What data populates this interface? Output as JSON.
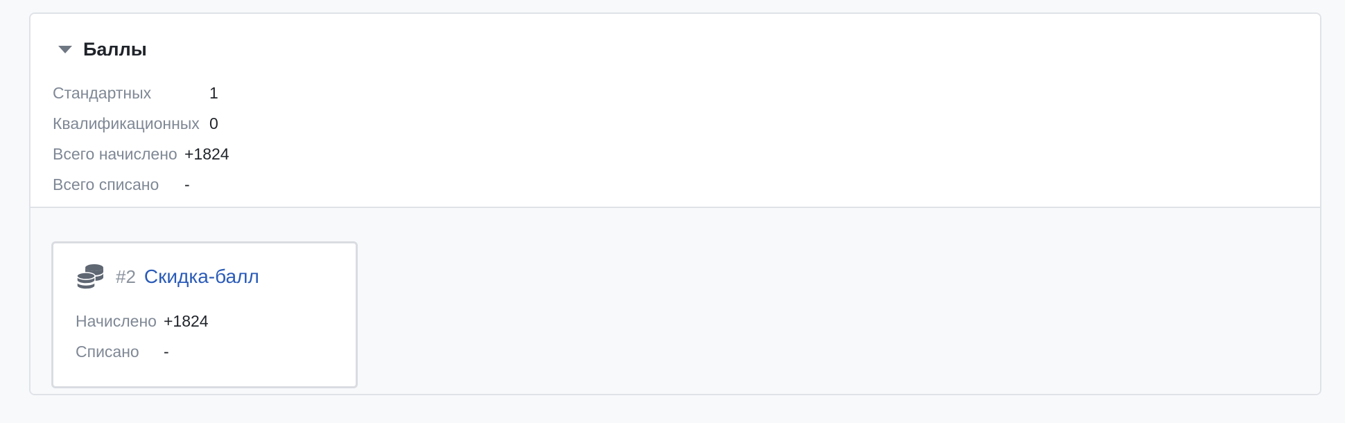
{
  "summary": {
    "title": "Баллы",
    "rows": [
      {
        "label": "Стандартных",
        "value": "1"
      },
      {
        "label": "Квалификационных",
        "value": "0"
      },
      {
        "label": "Всего начислено",
        "value": "+1824"
      },
      {
        "label": "Всего списано",
        "value": "-"
      }
    ]
  },
  "card": {
    "icon": "coins-stack-icon",
    "number": "#2",
    "title": "Скидка-балл",
    "rows": [
      {
        "label": "Начислено",
        "value": "+1824"
      },
      {
        "label": "Списано",
        "value": "-"
      }
    ]
  }
}
